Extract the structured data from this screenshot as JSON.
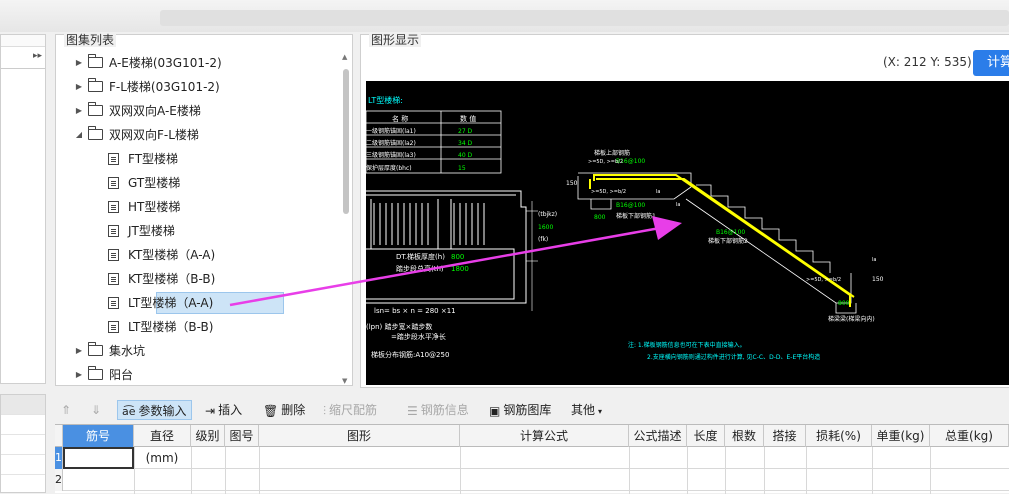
{
  "atlas": {
    "title": "图集列表",
    "items": [
      {
        "label": "A-E楼梯(03G101-2)",
        "type": "folder",
        "caret": "▶",
        "level": 0
      },
      {
        "label": "F-L楼梯(03G101-2)",
        "type": "folder",
        "caret": "▶",
        "level": 0
      },
      {
        "label": "双网双向A-E楼梯",
        "type": "folder",
        "caret": "▶",
        "level": 0
      },
      {
        "label": "双网双向F-L楼梯",
        "type": "folder",
        "caret": "◢",
        "level": 0
      },
      {
        "label": "FT型楼梯",
        "type": "doc",
        "level": 1
      },
      {
        "label": "GT型楼梯",
        "type": "doc",
        "level": 1
      },
      {
        "label": "HT型楼梯",
        "type": "doc",
        "level": 1
      },
      {
        "label": "JT型楼梯",
        "type": "doc",
        "level": 1
      },
      {
        "label": "KT型楼梯（A-A)",
        "type": "doc",
        "level": 1
      },
      {
        "label": "KT型楼梯（B-B)",
        "type": "doc",
        "level": 1
      },
      {
        "label": "LT型楼梯（A-A)",
        "type": "doc",
        "level": 1,
        "selected": true
      },
      {
        "label": "LT型楼梯（B-B)",
        "type": "doc",
        "level": 1
      },
      {
        "label": "集水坑",
        "type": "folder",
        "caret": "▶",
        "level": 0
      },
      {
        "label": "阳台",
        "type": "folder",
        "caret": "▶",
        "level": 0
      }
    ]
  },
  "graphic": {
    "title": "图形显示",
    "coord": "(X: 212 Y: 535)",
    "calc_button": "计算",
    "drawing": {
      "table_title": "LT型楼梯:",
      "table_headers": [
        "名 称",
        "数 值"
      ],
      "table_rows": [
        {
          "name": "一级钢筋锚固(la1)",
          "value": "27 D"
        },
        {
          "name": "二级钢筋锚固(la2)",
          "value": "34 D"
        },
        {
          "name": "三级钢筋锚固(la3)",
          "value": "40 D"
        },
        {
          "name": "保护层厚度(bhc)",
          "value": "15"
        }
      ],
      "labels": {
        "top_bar": "B16@100",
        "top_note": "梯板上部钢筋",
        "bot_note": "梯板下部钢筋1",
        "bot_bar": "B16@100",
        "bot2_bar": "B16@100",
        "bot2_note": "梯板下部钢筋2",
        "la1": "la",
        "la2": "la",
        "la3": "la",
        "d150a": "150",
        "d150b": "150",
        "d800a": "800",
        "d800b": "800",
        "dim_tbjkz": "(tbjkz)",
        "dim_1600": "1600",
        "dim_fk": "(fk)",
        "left_dt": "DT.梯板厚度(h)",
        "left_dt_val": "800",
        "left_ts": "踏步段总高(th)",
        "left_ts_val": "1800",
        "bottom_calc": "lsn= bs × n = 280 ×11",
        "bottom_calc2": "(lpn) 踏步宽×踏步数",
        "bottom_calc3": "=踏步段水平净长",
        "dist_bar": "梯板分布钢筋:A10@250",
        "beam_note": "梯梁梁(梯梁向内)",
        "hook1": ">=5D, >=b/2",
        "hook2": ">=5D, >=b/2",
        "note1": "注: 1.梯板钢筋信息也可在下表中直接输入。",
        "note2": "2.支座横向钢筋则通过构件进行计算, 见C-C、D-D、E-E平台构造"
      }
    }
  },
  "toolbar": {
    "param_input": "参数输入",
    "insert": "插入",
    "delete": "删除",
    "scale_rebar": "缩尺配筋",
    "rebar_info": "钢筋信息",
    "rebar_library": "钢筋图库",
    "more": "其他"
  },
  "table": {
    "columns": [
      "筋号",
      "直径(mm)",
      "级别",
      "图号",
      "图形",
      "计算公式",
      "公式描述",
      "长度",
      "根数",
      "搭接",
      "损耗(%)",
      "单重(kg)",
      "总重(kg)"
    ],
    "rows": [
      "1",
      "2"
    ]
  },
  "colors": {
    "accent": "#2b7de9",
    "selection": "#cde4f7",
    "canvas_bg": "#000000",
    "drawing_green": "#00ff00",
    "drawing_yellow": "#ffff00",
    "drawing_cyan": "#00ffff",
    "arrow_magenta": "#e83ee8"
  }
}
